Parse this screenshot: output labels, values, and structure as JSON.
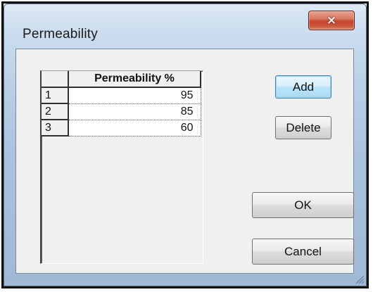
{
  "window": {
    "title": "Permeability",
    "close_icon": "close-icon"
  },
  "grid": {
    "column_header": "Permeability %",
    "rows": [
      {
        "index": "1",
        "value": "95"
      },
      {
        "index": "2",
        "value": "85"
      },
      {
        "index": "3",
        "value": "60"
      }
    ]
  },
  "buttons": {
    "add": "Add",
    "delete": "Delete",
    "ok": "OK",
    "cancel": "Cancel"
  },
  "icons": {
    "close": "×",
    "resize": "resize-grip-icon"
  },
  "colors": {
    "frame": "#a9c2dd",
    "close_button": "#c5452a",
    "default_button_border": "#3c7fb1"
  }
}
